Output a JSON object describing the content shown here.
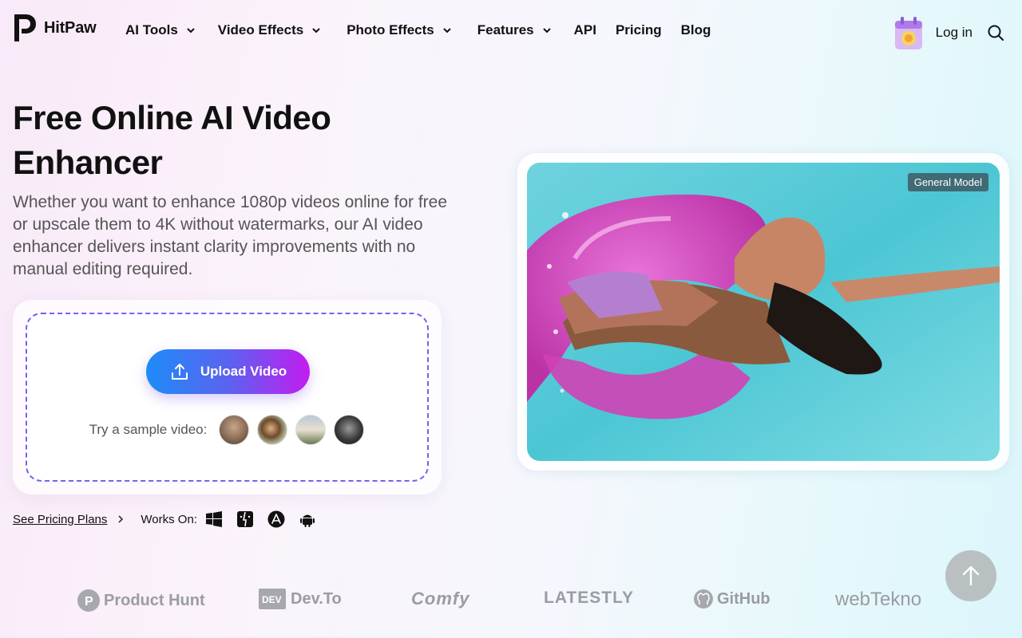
{
  "brand": {
    "name": "HitPaw"
  },
  "nav": {
    "items": [
      {
        "label": "AI Tools",
        "dropdown": true
      },
      {
        "label": "Video Effects",
        "dropdown": true
      },
      {
        "label": "Photo Effects",
        "dropdown": true
      },
      {
        "label": "Features",
        "dropdown": true
      },
      {
        "label": "API",
        "dropdown": false
      },
      {
        "label": "Pricing",
        "dropdown": false
      },
      {
        "label": "Blog",
        "dropdown": false
      }
    ],
    "login_label": "Log in"
  },
  "hero": {
    "title": "Free Online AI Video Enhancer",
    "description": "Whether you want to enhance 1080p videos online for free or upscale them to 4K without watermarks, our AI video enhancer delivers instant clarity improvements with no manual editing required."
  },
  "upload": {
    "button_label": "Upload Video",
    "sample_label": "Try a sample video:",
    "samples": [
      "sample-1",
      "sample-2",
      "sample-3",
      "sample-4"
    ]
  },
  "footer_links": {
    "pricing_label": "See Pricing Plans",
    "works_on_label": "Works On:",
    "platforms": [
      "windows-icon",
      "mac-finder-icon",
      "app-store-icon",
      "android-icon"
    ]
  },
  "preview": {
    "badge": "General Model"
  },
  "partners": [
    "Product Hunt",
    "Dev.To",
    "Comfy",
    "LATESTLY",
    "GitHub",
    "webTekno"
  ],
  "colors": {
    "accent_start": "#1d8cf8",
    "accent_end": "#c41cf0",
    "dash_border": "#7560f2"
  }
}
